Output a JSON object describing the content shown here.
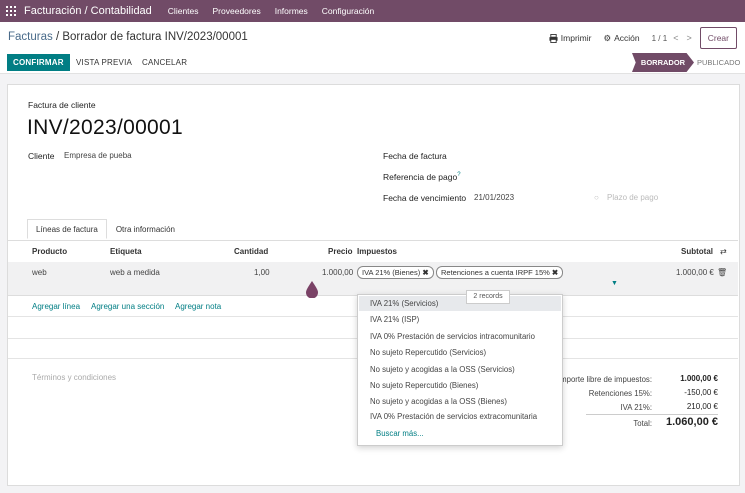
{
  "topbar": {
    "app_title": "Facturación / Contabilidad",
    "menu": [
      "Clientes",
      "Proveedores",
      "Informes",
      "Configuración"
    ]
  },
  "control_panel": {
    "breadcrumb_parent": "Facturas",
    "breadcrumb_sep": "/",
    "breadcrumb_current": "Borrador de factura INV/2023/00001",
    "print_label": "Imprimir",
    "action_label": "Acción",
    "pager": "1 / 1",
    "create_label": "Crear"
  },
  "statusbar": {
    "confirm_label": "CONFIRMAR",
    "preview_label": "VISTA PREVIA",
    "cancel_label": "CANCELAR",
    "stage_active": "BORRADOR",
    "stage_next": "PUBLICADO"
  },
  "form": {
    "doc_type": "Factura de cliente",
    "number": "INV/2023/00001",
    "customer_label": "Cliente",
    "customer_value": "Empresa de pueba",
    "invoice_date_label": "Fecha de factura",
    "payment_ref_label": "Referencia de pago",
    "payment_ref_sup": "?",
    "due_date_label": "Fecha de vencimiento",
    "due_date_value": "21/01/2023",
    "payment_terms_placeholder": "Plazo de pago"
  },
  "tabs": [
    "Líneas de factura",
    "Otra información"
  ],
  "lines": {
    "headers": {
      "product": "Producto",
      "label": "Etiqueta",
      "quantity": "Cantidad",
      "price": "Precio",
      "taxes": "Impuestos",
      "subtotal": "Subtotal"
    },
    "row": {
      "product": "web",
      "label": "web a medida",
      "quantity": "1,00",
      "price": "1.000,00",
      "tax_tags": [
        "IVA 21% (Bienes)",
        "Retenciones a cuenta IRPF 15%"
      ],
      "subtotal": "1.000,00 €"
    },
    "tooltip": "2 records",
    "add_line": "Agregar línea",
    "add_section": "Agregar una sección",
    "add_note": "Agregar nota"
  },
  "dropdown": {
    "options": [
      "IVA 21% (Servicios)",
      "IVA 21% (ISP)",
      "IVA 0% Prestación de servicios intracomunitario",
      "No sujeto Repercutido (Servicios)",
      "No sujeto y acogidas a la OSS (Servicios)",
      "No sujeto Repercutido (Bienes)",
      "No sujeto y acogidas a la OSS (Bienes)",
      "IVA 0% Prestación de servicios extracomunitaria"
    ],
    "search_more": "Buscar más..."
  },
  "terms_placeholder": "Términos y condiciones",
  "totals": {
    "untaxed_label": "Importe libre de impuestos:",
    "untaxed_value": "1.000,00 €",
    "ret_label": "Retenciones 15%:",
    "ret_value": "-150,00 €",
    "iva_label": "IVA 21%:",
    "iva_value": "210,00 €",
    "total_label": "Total:",
    "total_value": "1.060,00 €"
  },
  "colors": {
    "brand": "#714b67",
    "primary": "#017e84"
  }
}
